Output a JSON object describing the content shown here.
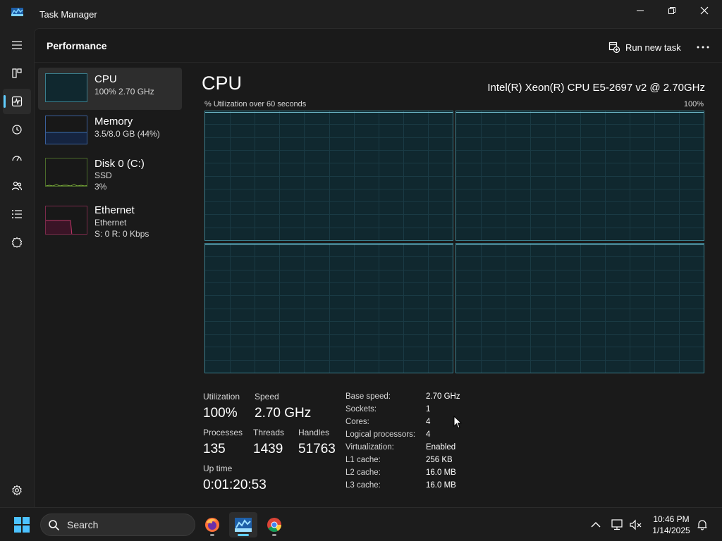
{
  "window": {
    "title": "Task Manager"
  },
  "header": {
    "title": "Performance",
    "run_new_task": "Run new task"
  },
  "sidebar": {
    "resources": [
      {
        "name": "CPU",
        "sub1": "100% 2.70 GHz",
        "sub2": ""
      },
      {
        "name": "Memory",
        "sub1": "3.5/8.0 GB (44%)",
        "sub2": ""
      },
      {
        "name": "Disk 0 (C:)",
        "sub1": "SSD",
        "sub2": "3%"
      },
      {
        "name": "Ethernet",
        "sub1": "Ethernet",
        "sub2": "S: 0 R: 0 Kbps"
      }
    ]
  },
  "cpu": {
    "title": "CPU",
    "model": "Intel(R) Xeon(R) CPU E5-2697 v2 @ 2.70GHz",
    "graph_caption": "% Utilization over 60 seconds",
    "graph_max": "100%",
    "utilization_fraction": 1.0,
    "stats": {
      "utilization_label": "Utilization",
      "utilization_value": "100%",
      "speed_label": "Speed",
      "speed_value": "2.70 GHz",
      "processes_label": "Processes",
      "processes_value": "135",
      "threads_label": "Threads",
      "threads_value": "1439",
      "handles_label": "Handles",
      "handles_value": "51763",
      "uptime_label": "Up time",
      "uptime_value": "0:01:20:53"
    },
    "specs": [
      {
        "key": "Base speed:",
        "value": "2.70 GHz"
      },
      {
        "key": "Sockets:",
        "value": "1"
      },
      {
        "key": "Cores:",
        "value": "4"
      },
      {
        "key": "Logical processors:",
        "value": "4"
      },
      {
        "key": "Virtualization:",
        "value": "Enabled"
      },
      {
        "key": "L1 cache:",
        "value": "256 KB"
      },
      {
        "key": "L2 cache:",
        "value": "16.0 MB"
      },
      {
        "key": "L3 cache:",
        "value": "16.0 MB"
      }
    ]
  },
  "taskbar": {
    "search_placeholder": "Search",
    "time": "10:46 PM",
    "date": "1/14/2025"
  },
  "colors": {
    "accent": "#60cdff",
    "cpu_graph_fill": "#10282f",
    "cpu_graph_border": "#3a7d8c",
    "memory_line": "#3a6fb5",
    "disk_line": "#7fb33a",
    "ethernet_line": "#c2386a"
  }
}
